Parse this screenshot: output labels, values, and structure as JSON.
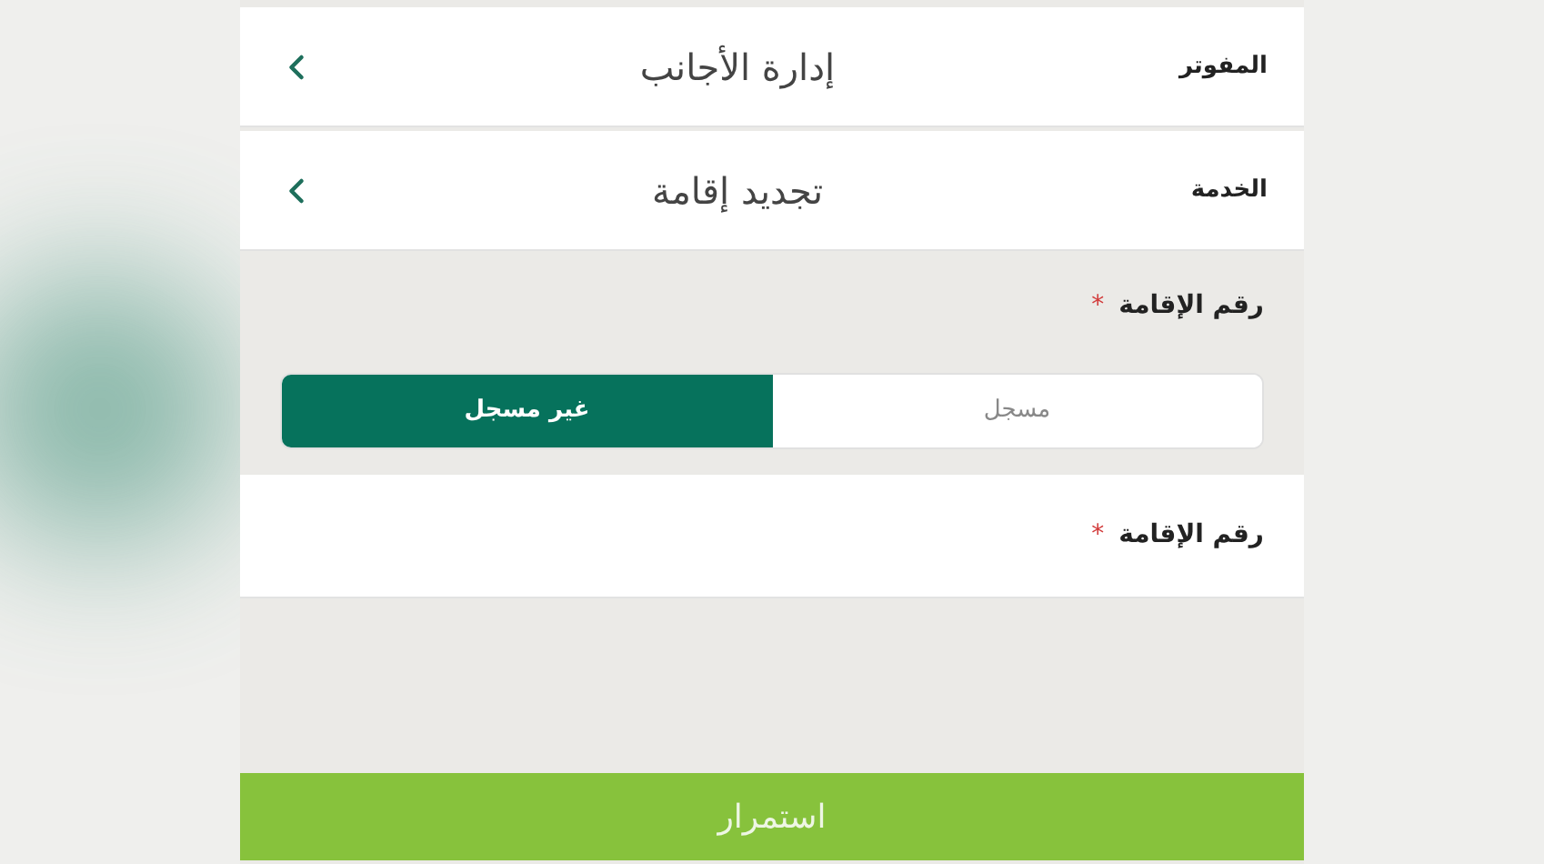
{
  "rows": [
    {
      "label": "المفوتر",
      "value": "إدارة الأجانب"
    },
    {
      "label": "الخدمة",
      "value": "تجديد إقامة"
    }
  ],
  "status_field": {
    "label": "رقم الإقامة",
    "required_mark": "*",
    "options": [
      {
        "label": "مسجل",
        "selected": false
      },
      {
        "label": "غير مسجل",
        "selected": true
      }
    ]
  },
  "id_field": {
    "label": "رقم الإقامة",
    "required_mark": "*"
  },
  "continue_button": "استمرار"
}
